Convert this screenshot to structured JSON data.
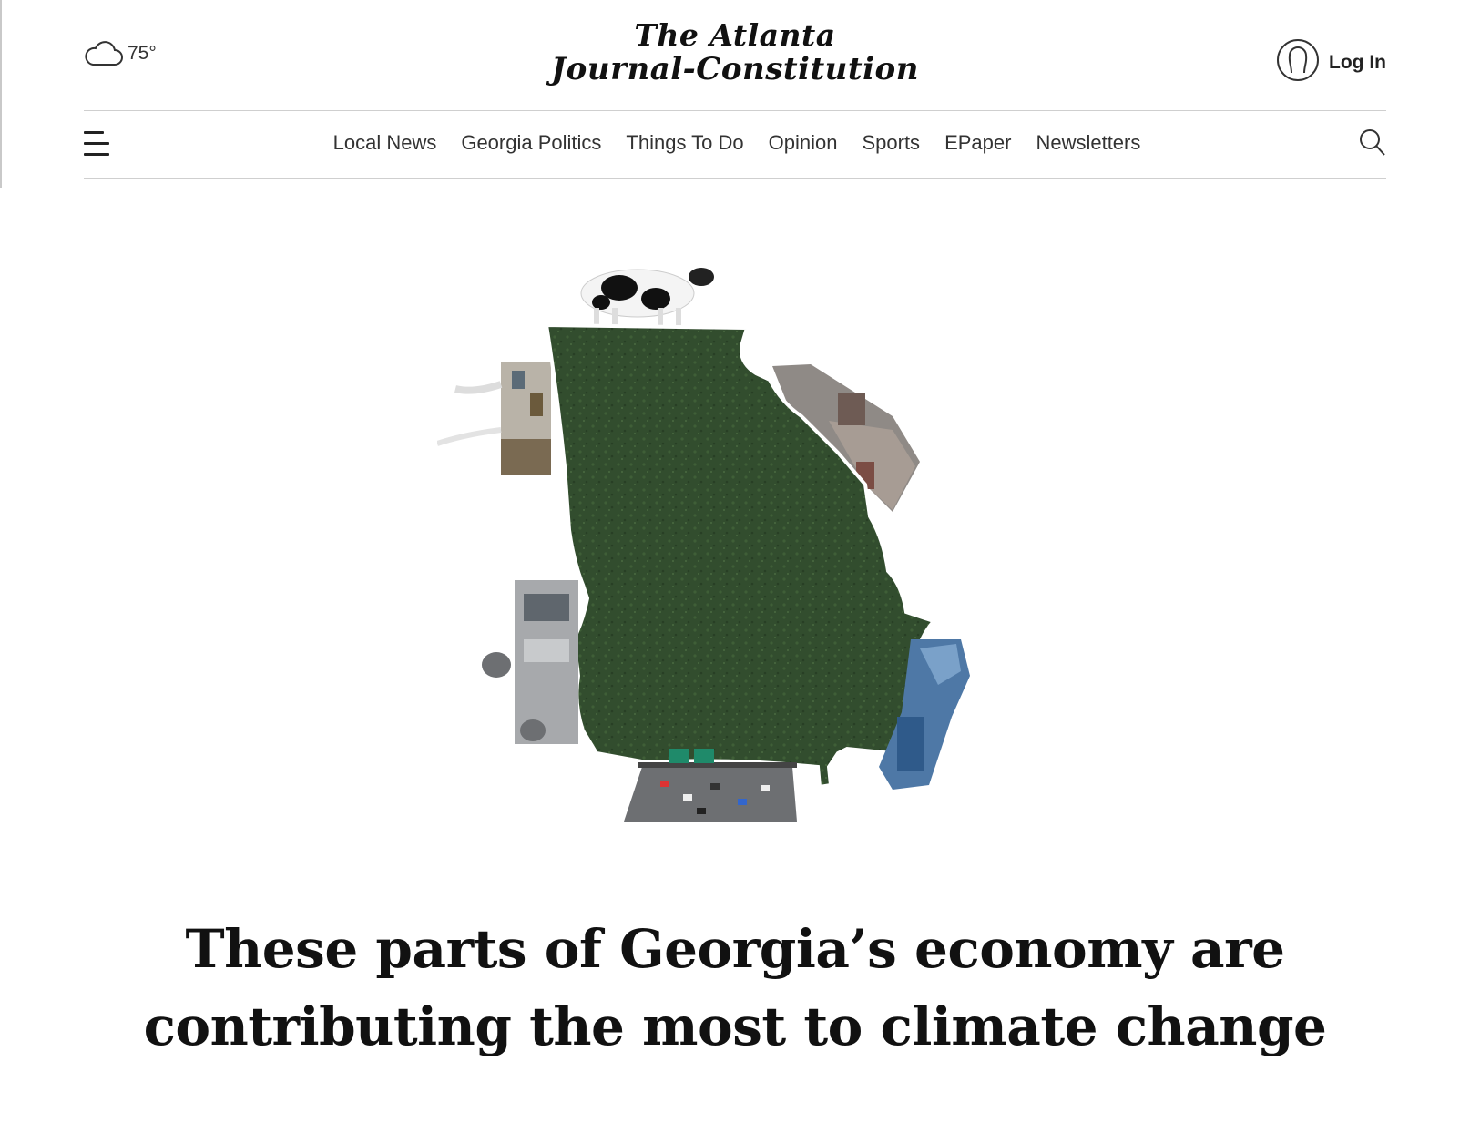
{
  "header": {
    "weather": {
      "icon": "cloud-icon",
      "temperature": "75°"
    },
    "masthead": {
      "line1": "The Atlanta",
      "line2": "Journal-Constitution"
    },
    "login": {
      "icon": "user-avatar-icon",
      "label": "Log In"
    }
  },
  "nav": {
    "menu_icon": "hamburger-menu-icon",
    "items": [
      {
        "label": "Local News"
      },
      {
        "label": "Georgia Politics"
      },
      {
        "label": "Things To Do"
      },
      {
        "label": "Opinion"
      },
      {
        "label": "Sports"
      },
      {
        "label": "EPaper"
      },
      {
        "label": "Newsletters"
      }
    ],
    "search_icon": "search-icon"
  },
  "article": {
    "headline": "These parts of Georgia’s economy are contributing the most to climate change"
  },
  "colors": {
    "map_green": "#2f4a2c",
    "text": "#111111",
    "divider": "#cfcfcf"
  }
}
